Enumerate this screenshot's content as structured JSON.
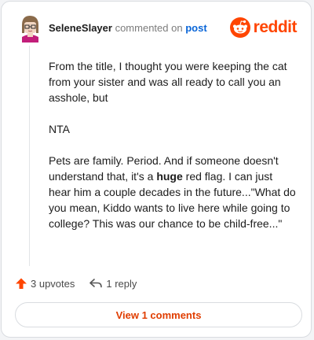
{
  "comment": {
    "username": "SeleneSlayer",
    "action_text": "commented on",
    "post_link": "post",
    "brand": "reddit",
    "paragraphs": {
      "p1": "From the title, I thought you were keeping the cat from your sister and was all ready to call you an asshole, but",
      "p2": "NTA",
      "p3_before": "Pets are family. Period. And if someone doesn't understand that, it's a ",
      "p3_bold": "huge",
      "p3_after": " red flag. I can just hear him a couple decades in the future...\"What do you mean, Kiddo wants to live here while going to college? This was our chance to be child-free...\""
    }
  },
  "actions": {
    "upvotes_label": "3 upvotes",
    "reply_label": "1 reply"
  },
  "footer": {
    "view_comments_label": "View 1 comments"
  },
  "colors": {
    "brand_orange": "#ff4500",
    "upvote_orange": "#ff4500",
    "link_blue": "#0a66d8",
    "view_button_text": "#e03d00"
  },
  "icons": {
    "avatar": "cartoon-avatar",
    "brand_logo": "reddit-snoo-icon",
    "upvote": "upvote-arrow-icon",
    "reply": "reply-arrow-icon"
  }
}
